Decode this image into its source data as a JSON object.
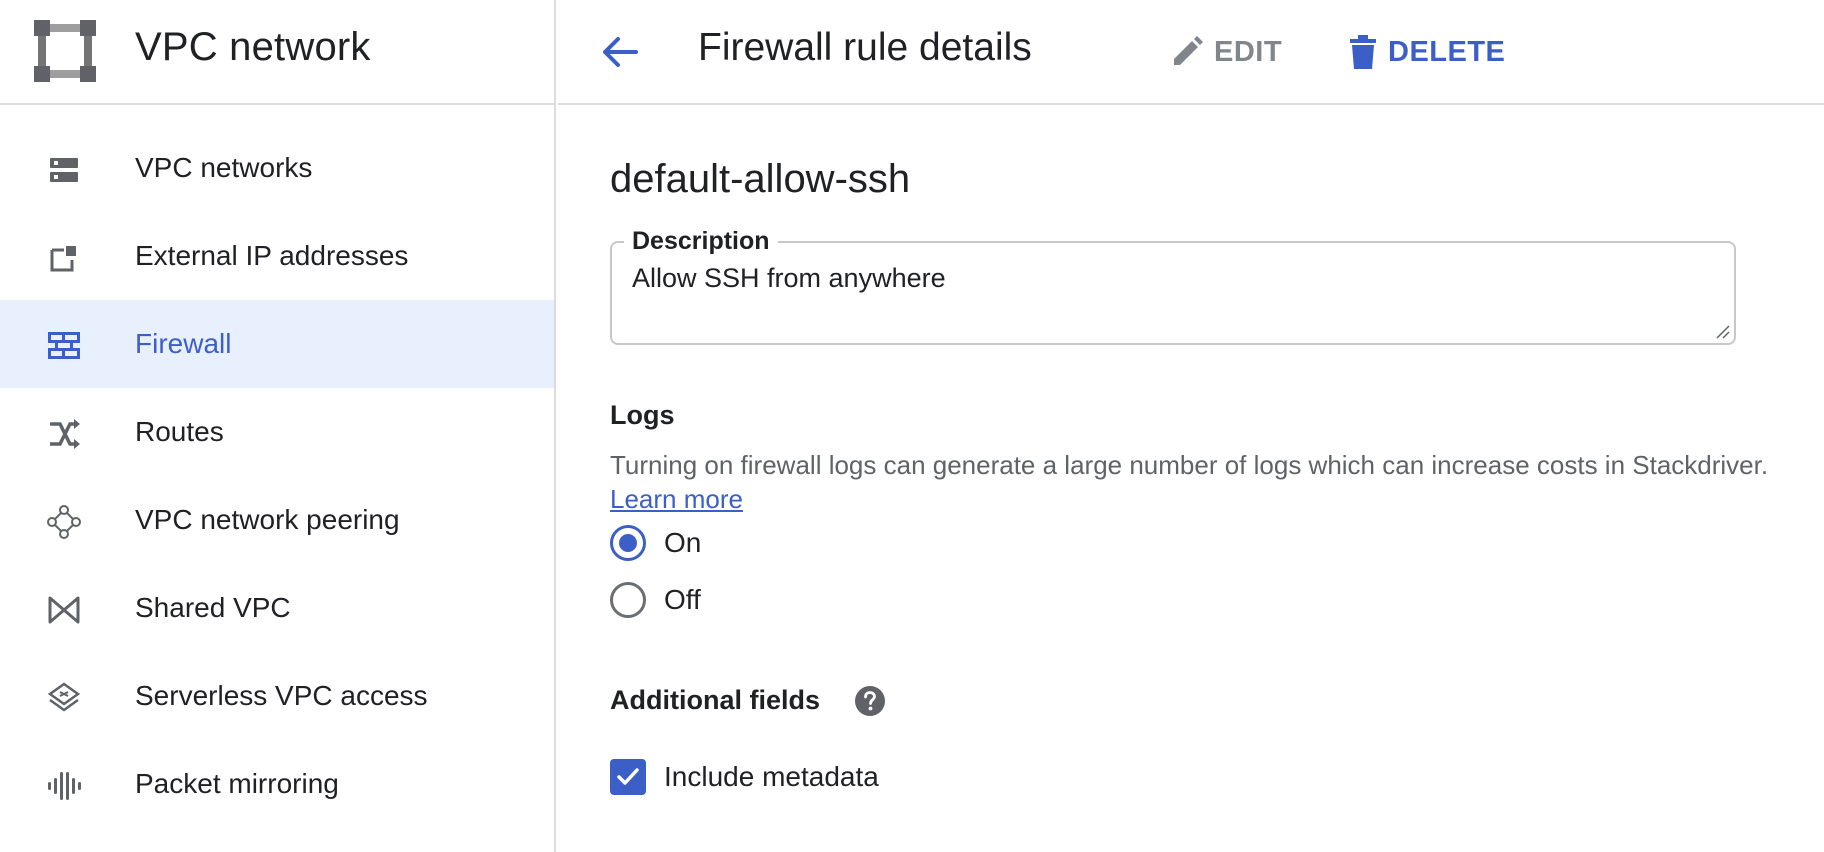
{
  "sidebar": {
    "title": "VPC network",
    "logo_icon": "vpc-network-logo",
    "items": [
      {
        "label": "VPC networks",
        "icon": "vpc-networks-icon",
        "active": false
      },
      {
        "label": "External IP addresses",
        "icon": "external-ip-icon",
        "active": false
      },
      {
        "label": "Firewall",
        "icon": "firewall-icon",
        "active": true
      },
      {
        "label": "Routes",
        "icon": "routes-icon",
        "active": false
      },
      {
        "label": "VPC network peering",
        "icon": "peering-icon",
        "active": false
      },
      {
        "label": "Shared VPC",
        "icon": "shared-vpc-icon",
        "active": false
      },
      {
        "label": "Serverless VPC access",
        "icon": "serverless-vpc-icon",
        "active": false
      },
      {
        "label": "Packet mirroring",
        "icon": "packet-mirroring-icon",
        "active": false
      }
    ]
  },
  "header": {
    "title": "Firewall rule details",
    "edit_label": "EDIT",
    "delete_label": "DELETE"
  },
  "rule": {
    "name": "default-allow-ssh",
    "description_label": "Description",
    "description_value": "Allow SSH from anywhere"
  },
  "logs": {
    "title": "Logs",
    "text": "Turning on firewall logs can generate a large number of logs which can increase costs in Stackdriver.",
    "learn_more": "Learn more",
    "options": [
      {
        "label": "On",
        "selected": true
      },
      {
        "label": "Off",
        "selected": false
      }
    ]
  },
  "additional_fields": {
    "title": "Additional fields",
    "include_metadata_label": "Include metadata",
    "include_metadata_checked": true
  },
  "colors": {
    "accent": "#3b5fc7",
    "active_bg": "#e8f0fe",
    "muted": "#80868b",
    "divider": "#dadce0"
  }
}
